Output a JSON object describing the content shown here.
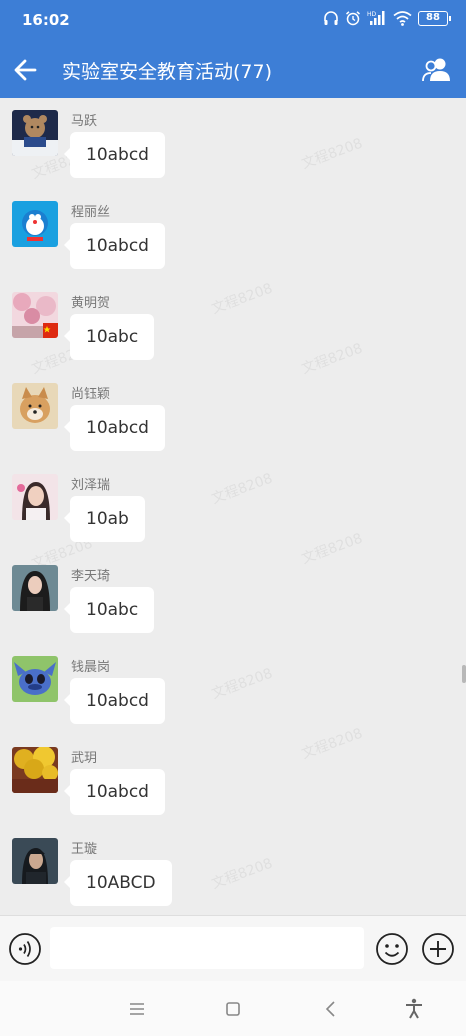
{
  "status_bar": {
    "time": "16:02",
    "battery": "88",
    "network_badge": "HD"
  },
  "header": {
    "title": "实验室安全教育活动(77)"
  },
  "watermark": "文程8208",
  "messages": [
    {
      "sender": "马跃",
      "text": "10abcd",
      "avatar": "teddy-bear-book"
    },
    {
      "sender": "程丽丝",
      "text": "10abcd",
      "avatar": "doraemon"
    },
    {
      "sender": "黄明贺",
      "text": "10abc",
      "avatar": "cherry-blossom-flag"
    },
    {
      "sender": "尚钰颖",
      "text": "10abcd",
      "avatar": "shiba-dog"
    },
    {
      "sender": "刘泽瑞",
      "text": "10ab",
      "avatar": "girl-pink"
    },
    {
      "sender": "李天琦",
      "text": "10abc",
      "avatar": "girl-dark-hair"
    },
    {
      "sender": "钱晨岗",
      "text": "10abcd",
      "avatar": "stitch"
    },
    {
      "sender": "武玥",
      "text": "10abcd",
      "avatar": "ginkgo-tree"
    },
    {
      "sender": "王璇",
      "text": "10ABCD",
      "avatar": "man-portrait"
    }
  ],
  "input": {
    "placeholder": ""
  },
  "colors": {
    "header_bg": "#3d7ed6",
    "chat_bg": "#ededed",
    "bubble_bg": "#ffffff"
  }
}
